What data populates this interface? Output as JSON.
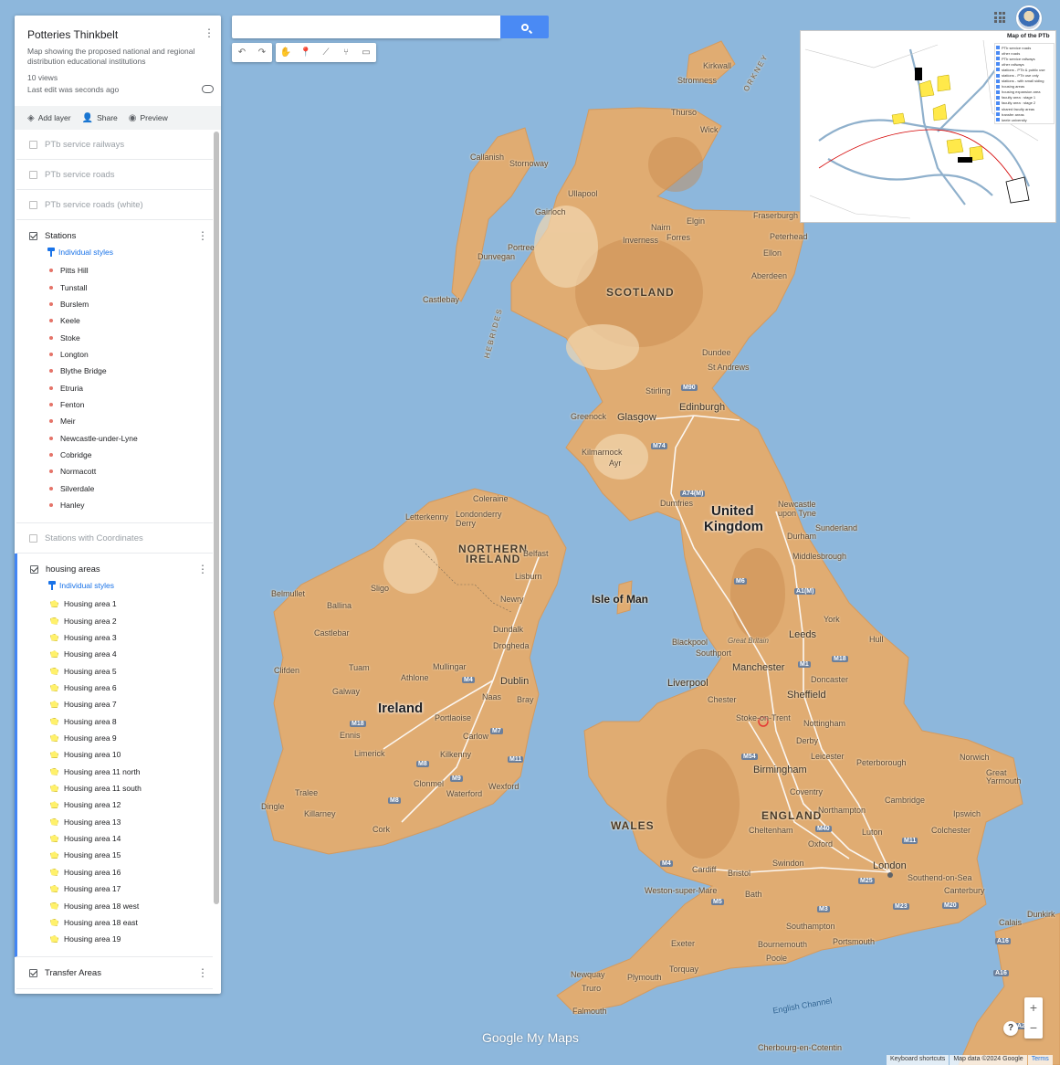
{
  "header": {
    "title": "Potteries Thinkbelt",
    "description": "Map showing the proposed national and regional distribution educational institutions",
    "views": "10 views",
    "last_edit": "Last edit was seconds ago"
  },
  "toolbar": {
    "add_layer": "Add layer",
    "share": "Share",
    "preview": "Preview"
  },
  "layers": {
    "railways": "PTb service railways",
    "roads": "PTb service roads",
    "roads_white": "PTb service roads (white)",
    "stations": {
      "name": "Stations",
      "style": "Individual styles",
      "items": [
        "Pitts Hill",
        "Tunstall",
        "Burslem",
        "Keele",
        "Stoke",
        "Longton",
        "Blythe Bridge",
        "Etruria",
        "Fenton",
        "Meir",
        "Newcastle-under-Lyne",
        "Cobridge",
        "Normacott",
        "Silverdale",
        "Hanley"
      ]
    },
    "stations_coords": "Stations with Coordinates",
    "housing": {
      "name": "housing areas",
      "style": "Individual styles",
      "items": [
        "Housing area 1",
        "Housing area 2",
        "Housing area 3",
        "Housing area 4",
        "Housing area 5",
        "Housing area 6",
        "Housing area 7",
        "Housing area 8",
        "Housing area 9",
        "Housing area 10",
        "Housing area 11 north",
        "Housing area 11 south",
        "Housing area 12",
        "Housing area 13",
        "Housing area 14",
        "Housing area 15",
        "Housing area 16",
        "Housing area 17",
        "Housing area 18 west",
        "Housing area 18 east",
        "Housing area 19"
      ]
    },
    "transfer": "Transfer Areas"
  },
  "inset": {
    "title": "Map of the PTb",
    "legend": [
      "PTb service roads",
      "other roads",
      "PTb service railways",
      "other railways",
      "stations - PTb & public use",
      "stations - PTb use only",
      "stations - with small siding",
      "housing areas",
      "housing expansion area",
      "faculty area : stage 1",
      "faculty area : stage 2",
      "shared faculty areas",
      "transfer areas",
      "keele university"
    ]
  },
  "map": {
    "labels": {
      "scotland": "SCOTLAND",
      "uk_line1": "United",
      "uk_line2": "Kingdom",
      "ni_line1": "NORTHERN",
      "ni_line2": "IRELAND",
      "ireland": "Ireland",
      "isle_of_man": "Isle of Man",
      "wales": "WALES",
      "england": "ENGLAND",
      "great_britain": "Great Britain",
      "hebrides": "HEBRIDES",
      "orkney": "ORKNEY",
      "english_channel": "English Channel"
    },
    "cities": {
      "kirkwall": "Kirkwall",
      "stromness": "Stromness",
      "thurso": "Thurso",
      "wick": "Wick",
      "callanish": "Callanish",
      "stornoway": "Stornoway",
      "ullapool": "Ullapool",
      "gairloch": "Gairloch",
      "nairn": "Nairn",
      "elgin": "Elgin",
      "fraserburgh": "Fraserburgh",
      "inverness": "Inverness",
      "forres": "Forres",
      "peterhead": "Peterhead",
      "portree": "Portree",
      "dunvegan": "Dunvegan",
      "ellon": "Ellon",
      "aberdeen": "Aberdeen",
      "castlebay": "Castlebay",
      "dundee": "Dundee",
      "st_andrews": "St Andrews",
      "stirling": "Stirling",
      "edinburgh": "Edinburgh",
      "greenock": "Greenock",
      "glasgow": "Glasgow",
      "kilmarnock": "Kilmarnock",
      "ayr": "Ayr",
      "dumfries": "Dumfries",
      "newcastle": "Newcastle upon Tyne",
      "sunderland": "Sunderland",
      "durham": "Durham",
      "middlesbrough": "Middlesbrough",
      "coleraine": "Coleraine",
      "londonderry": "Londonderry",
      "derry": "Derry",
      "letterkenny": "Letterkenny",
      "belfast": "Belfast",
      "lisburn": "Lisburn",
      "sligo": "Sligo",
      "newry": "Newry",
      "belmullet": "Belmullet",
      "ballina": "Ballina",
      "dundalk": "Dundalk",
      "castlebar": "Castlebar",
      "drogheda": "Drogheda",
      "clifden": "Clifden",
      "tuam": "Tuam",
      "mullingar": "Mullingar",
      "athlone": "Athlone",
      "dublin": "Dublin",
      "galway": "Galway",
      "naas": "Naas",
      "bray": "Bray",
      "portlaoise": "Portlaoise",
      "ennis": "Ennis",
      "carlow": "Carlow",
      "limerick": "Limerick",
      "kilkenny": "Kilkenny",
      "clonmel": "Clonmel",
      "wexford": "Wexford",
      "tralee": "Tralee",
      "waterford": "Waterford",
      "dingle": "Dingle",
      "killarney": "Killarney",
      "cork": "Cork",
      "york": "York",
      "leeds": "Leeds",
      "hull": "Hull",
      "blackpool": "Blackpool",
      "southport": "Southport",
      "manchester": "Manchester",
      "doncaster": "Doncaster",
      "liverpool": "Liverpool",
      "sheffield": "Sheffield",
      "chester": "Chester",
      "stoke": "Stoke-on-Trent",
      "nottingham": "Nottingham",
      "derby": "Derby",
      "leicester": "Leicester",
      "peterborough": "Peterborough",
      "norwich": "Norwich",
      "birmingham": "Birmingham",
      "great_yarmouth": "Great Yarmouth",
      "coventry": "Coventry",
      "cambridge": "Cambridge",
      "northampton": "Northampton",
      "ipswich": "Ipswich",
      "cheltenham": "Cheltenham",
      "luton": "Luton",
      "colchester": "Colchester",
      "oxford": "Oxford",
      "swindon": "Swindon",
      "london": "London",
      "cardiff": "Cardiff",
      "bristol": "Bristol",
      "southend": "Southend-on-Sea",
      "weston": "Weston-super-Mare",
      "canterbury": "Canterbury",
      "bath": "Bath",
      "calais": "Calais",
      "dunkirk": "Dunkirk",
      "southampton": "Southampton",
      "portsmouth": "Portsmouth",
      "exeter": "Exeter",
      "bournemouth": "Bournemouth",
      "poole": "Poole",
      "newquay": "Newquay",
      "torquay": "Torquay",
      "plymouth": "Plymouth",
      "truro": "Truro",
      "falmouth": "Falmouth",
      "cherbourg": "Cherbourg-en-Cotentin"
    },
    "roads": {
      "m90": "M90",
      "m74": "M74",
      "a74m": "A74(M)",
      "m6": "M6",
      "a1m": "A1(M)",
      "m1": "M1",
      "m18": "M18",
      "m4_ie": "M4",
      "m18_ie": "M18",
      "m8": "M8",
      "m9": "M9",
      "m11_ie": "M11",
      "m8b": "M8",
      "m7": "M7",
      "m54": "M54",
      "m40": "M40",
      "m11": "M11",
      "m4": "M4",
      "m25": "M25",
      "m5": "M5",
      "m3": "M3",
      "m23": "M23",
      "m20": "M20",
      "a16": "A16",
      "a16b": "A16",
      "a28": "A28"
    }
  },
  "brand": "Google My Maps",
  "footer": {
    "shortcuts": "Keyboard shortcuts",
    "attribution": "Map data ©2024 Google",
    "terms": "Terms"
  }
}
